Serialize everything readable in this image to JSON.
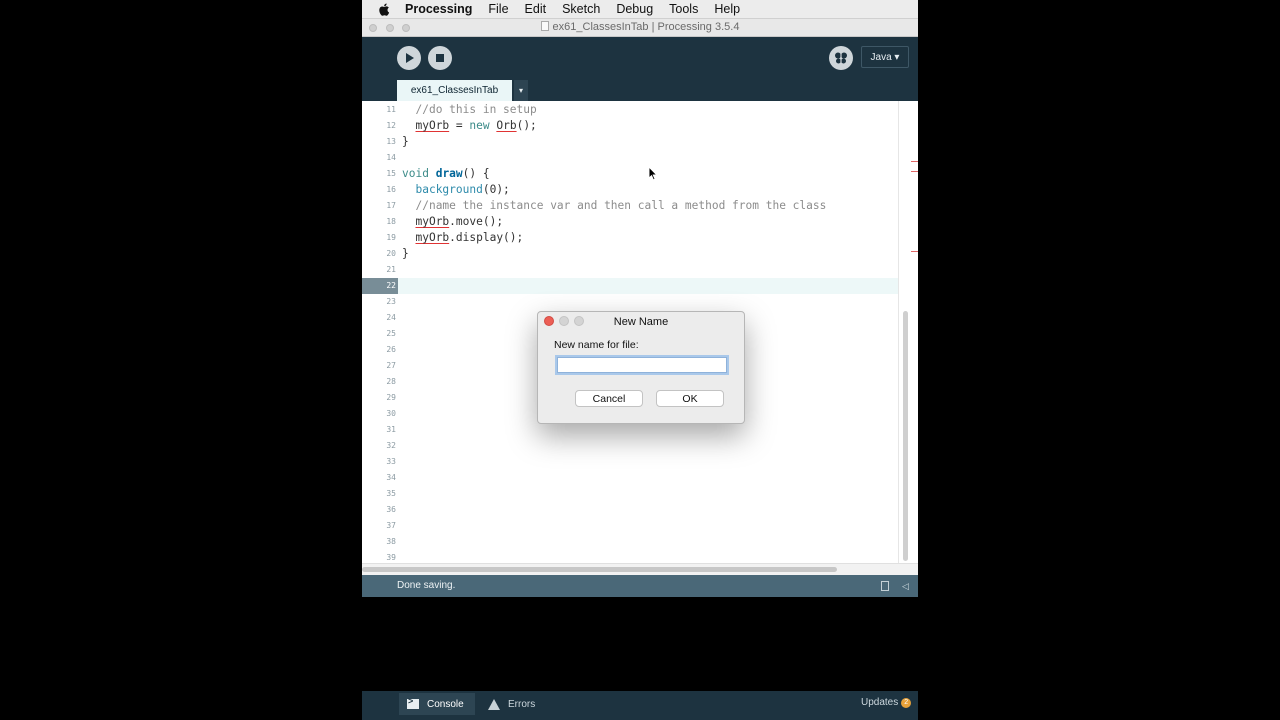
{
  "menubar": {
    "app_name": "Processing",
    "items": [
      "File",
      "Edit",
      "Sketch",
      "Debug",
      "Tools",
      "Help"
    ]
  },
  "window": {
    "title": "ex61_ClassesInTab | Processing 3.5.4"
  },
  "toolbar": {
    "mode": "Java ▾",
    "tab_name": "ex61_ClassesInTab",
    "tab_menu_glyph": "▾"
  },
  "editor": {
    "lines": [
      {
        "num": "11",
        "code": "  //do this in setup"
      },
      {
        "num": "12",
        "code": "  myOrb = new Orb();"
      },
      {
        "num": "13",
        "code": "}"
      },
      {
        "num": "14",
        "code": ""
      },
      {
        "num": "15",
        "code": "void draw() {"
      },
      {
        "num": "16",
        "code": "  background(0);"
      },
      {
        "num": "17",
        "code": "  //name the instance var and then call a method from the class"
      },
      {
        "num": "18",
        "code": "  myOrb.move();"
      },
      {
        "num": "19",
        "code": "  myOrb.display();"
      },
      {
        "num": "20",
        "code": "}"
      },
      {
        "num": "21",
        "code": ""
      },
      {
        "num": "22",
        "code": ""
      },
      {
        "num": "23",
        "code": ""
      },
      {
        "num": "24",
        "code": ""
      },
      {
        "num": "25",
        "code": ""
      },
      {
        "num": "26",
        "code": ""
      },
      {
        "num": "27",
        "code": ""
      },
      {
        "num": "28",
        "code": ""
      },
      {
        "num": "29",
        "code": ""
      },
      {
        "num": "30",
        "code": ""
      },
      {
        "num": "31",
        "code": ""
      },
      {
        "num": "32",
        "code": ""
      },
      {
        "num": "33",
        "code": ""
      },
      {
        "num": "34",
        "code": ""
      },
      {
        "num": "35",
        "code": ""
      },
      {
        "num": "36",
        "code": ""
      },
      {
        "num": "37",
        "code": ""
      },
      {
        "num": "38",
        "code": ""
      },
      {
        "num": "39",
        "code": ""
      }
    ]
  },
  "status": {
    "message": "Done saving."
  },
  "console": {
    "console_label": "Console",
    "errors_label": "Errors",
    "updates_label": "Updates",
    "updates_count": "2"
  },
  "dialog": {
    "title": "New Name",
    "label": "New name for file:",
    "input_value": "",
    "cancel_label": "Cancel",
    "ok_label": "OK"
  },
  "colors": {
    "toolbar_bg": "#1d3340",
    "tab_bg": "#eaf6f7",
    "status_bg": "#4a6878",
    "current_line_bg": "#edf8f8"
  }
}
